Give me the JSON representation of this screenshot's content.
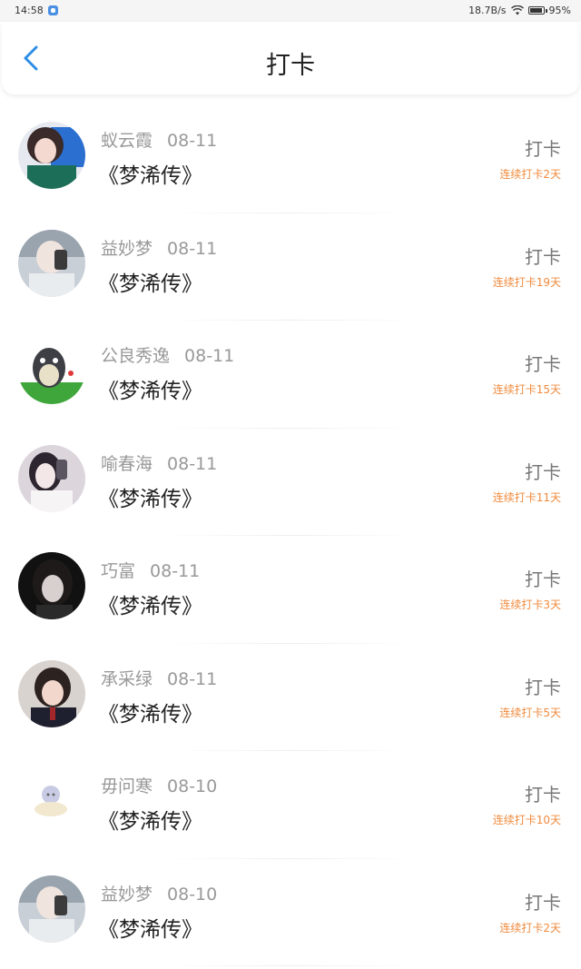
{
  "status_bar": {
    "time": "14:58",
    "net_speed": "18.7B/s",
    "battery": "95%"
  },
  "header": {
    "title": "打卡",
    "back_icon": "chevron-left-icon"
  },
  "colors": {
    "accent": "#2e8ee6",
    "streak": "#f08a3c",
    "name_gray": "#999999",
    "title_dark": "#222222"
  },
  "items": [
    {
      "name": "蚁云霞",
      "date": "08-11",
      "book": "《梦浠传》",
      "action": "打卡",
      "streak": "连续打卡2天"
    },
    {
      "name": "益妙梦",
      "date": "08-11",
      "book": "《梦浠传》",
      "action": "打卡",
      "streak": "连续打卡19天"
    },
    {
      "name": "公良秀逸",
      "date": "08-11",
      "book": "《梦浠传》",
      "action": "打卡",
      "streak": "连续打卡15天"
    },
    {
      "name": "喻春海",
      "date": "08-11",
      "book": "《梦浠传》",
      "action": "打卡",
      "streak": "连续打卡11天"
    },
    {
      "name": "巧富",
      "date": "08-11",
      "book": "《梦浠传》",
      "action": "打卡",
      "streak": "连续打卡3天"
    },
    {
      "name": "承采绿",
      "date": "08-11",
      "book": "《梦浠传》",
      "action": "打卡",
      "streak": "连续打卡5天"
    },
    {
      "name": "毋问寒",
      "date": "08-10",
      "book": "《梦浠传》",
      "action": "打卡",
      "streak": "连续打卡10天"
    },
    {
      "name": "益妙梦",
      "date": "08-10",
      "book": "《梦浠传》",
      "action": "打卡",
      "streak": "连续打卡2天"
    }
  ]
}
